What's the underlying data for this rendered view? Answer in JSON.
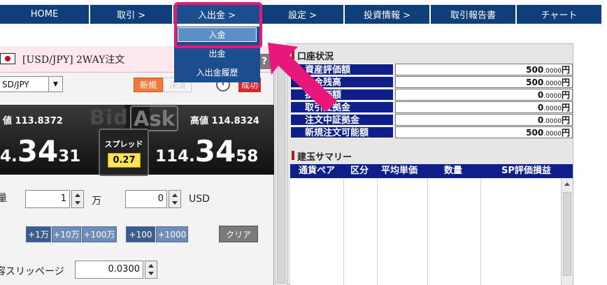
{
  "nav": {
    "items": [
      {
        "label": "HOME"
      },
      {
        "label": "取引 >"
      },
      {
        "label": "入出金 >"
      },
      {
        "label": "設定 >"
      },
      {
        "label": "投資情報 >"
      },
      {
        "label": "取引報告書"
      },
      {
        "label": "チャート"
      }
    ],
    "dropdown": [
      {
        "label": "入金"
      },
      {
        "label": "出金"
      },
      {
        "label": "入出金履歴"
      }
    ]
  },
  "order": {
    "title": "[USD/JPY] 2WAY注文",
    "help": "?",
    "pair_value": "SD/JPY",
    "new_label": "新規",
    "settle_label": "決済",
    "red_label": "成功",
    "low_label": "値 113.8372",
    "high_label": "高値  114.8324",
    "bid_word": "Bid",
    "ask_word": "Ask",
    "bid_price_small": "4.",
    "bid_price_big": "34",
    "bid_price_tail": "31",
    "ask_price_small": "114.",
    "ask_price_big": "34",
    "ask_price_tail": "58",
    "spread_label": "スプレッド",
    "spread_value": "0.27",
    "qty_label": "量",
    "qty_value": "1",
    "qty_unit": "万",
    "usd_value": "0",
    "usd_unit": "USD",
    "steps": [
      "+1万",
      "+10万",
      "+100万"
    ],
    "steps2": [
      "+100",
      "+1000"
    ],
    "clear_label": "クリア",
    "slip_label": "容スリッページ",
    "slip_value": "0.0300"
  },
  "account": {
    "title": "口座状況",
    "rows": [
      {
        "label": "資産評価額",
        "int": "500",
        "dec": ".0000",
        "unit": "円"
      },
      {
        "label": "託金残高",
        "int": "500",
        "dec": ".0000",
        "unit": "円"
      },
      {
        "label": "損評価額",
        "int": "0",
        "dec": ".0000",
        "unit": "円"
      },
      {
        "label": "取引証拠金",
        "int": "0",
        "dec": ".0000",
        "unit": "円"
      },
      {
        "label": "注文中証拠金",
        "int": "0",
        "dec": ".0000",
        "unit": "円"
      },
      {
        "label": "新規注文可能額",
        "int": "500",
        "dec": ".0000",
        "unit": "円"
      }
    ]
  },
  "summary": {
    "title": "建玉サマリー",
    "columns": [
      "通貨ペア",
      "区分",
      "平均単価",
      "数量",
      "SP評価損益"
    ]
  },
  "colors": {
    "nav": "#0f3f7a",
    "highlight": "#e8187a",
    "table_header": "#0f1f8a"
  }
}
